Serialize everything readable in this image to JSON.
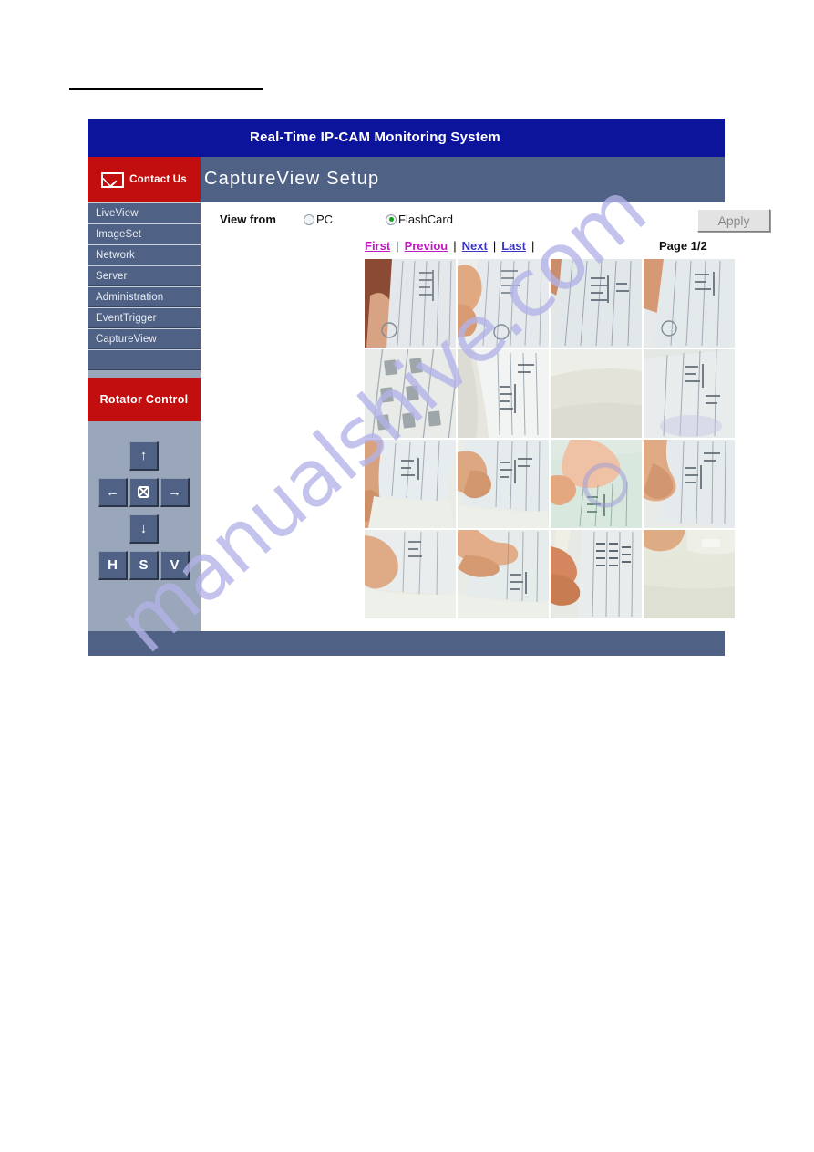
{
  "window": {
    "title": "Real-Time IP-CAM Monitoring System",
    "page_heading": "CaptureView Setup",
    "contact_us_label": "Contact Us",
    "contact_us_icon": "envelope-icon"
  },
  "colors": {
    "title_bar": "#0C149C",
    "header_band": "#4F6184",
    "accent_red": "#C20E0E",
    "sidebar_bg": "#9AA6BA",
    "nav_item": "#4F6184",
    "link_visited": "#C219C2",
    "link_fresh": "#3A34C9",
    "radio_checked": "#11A011",
    "watermark": "#B3B3E8"
  },
  "sidebar": {
    "items": [
      {
        "label": "LiveView"
      },
      {
        "label": "ImageSet"
      },
      {
        "label": "Network"
      },
      {
        "label": "Server"
      },
      {
        "label": "Administration"
      },
      {
        "label": "EventTrigger"
      },
      {
        "label": "CaptureView"
      },
      {
        "label": ""
      }
    ],
    "rotator": {
      "title": "Rotator Control",
      "buttons": [
        {
          "name": "up",
          "glyph": "↑",
          "icon": "arrow-up-icon"
        },
        {
          "name": "left",
          "glyph": "←",
          "icon": "arrow-left-icon"
        },
        {
          "name": "home",
          "glyph": "",
          "icon": "home-reset-icon"
        },
        {
          "name": "right",
          "glyph": "→",
          "icon": "arrow-right-icon"
        },
        {
          "name": "down",
          "glyph": "↓",
          "icon": "arrow-down-icon"
        },
        {
          "name": "h",
          "glyph": "H",
          "icon": "horizontal-scan-icon"
        },
        {
          "name": "s",
          "glyph": "S",
          "icon": "stop-scan-icon"
        },
        {
          "name": "v",
          "glyph": "V",
          "icon": "vertical-scan-icon"
        }
      ]
    }
  },
  "content": {
    "view_from": {
      "label": "View from",
      "options": [
        {
          "label": "PC",
          "checked": false
        },
        {
          "label": "FlashCard",
          "checked": true
        }
      ]
    },
    "apply_label": "Apply",
    "pager": {
      "first": "First",
      "previous": "Previou",
      "next": "Next",
      "last": "Last",
      "separator": "|",
      "page_indicator": "Page 1/2"
    },
    "thumbnails": {
      "rows": 4,
      "columns": 4,
      "count": 16,
      "items": [
        {
          "caption": "hand holding printed form, red-brown sleeve at left, round stamp lower-left"
        },
        {
          "caption": "fingers gripping white document sheet, round stamp lower-centre"
        },
        {
          "caption": "tilted printed form with columns of characters"
        },
        {
          "caption": "hand at left edge holding form, round stamp lower-left"
        },
        {
          "caption": "close-up of ruled table cells on pale paper"
        },
        {
          "caption": "curled white page with printed text block"
        },
        {
          "caption": "blurred pale paper surface, out of focus"
        },
        {
          "caption": "printed form on desk, lower right corner"
        },
        {
          "caption": "hand holding folded printed sheet"
        },
        {
          "caption": "fingers pointing at printed form rows"
        },
        {
          "caption": "pale green tinted paper with fingers over it"
        },
        {
          "caption": "hand with finger on form, text column at right"
        },
        {
          "caption": "blurred hand over white paper"
        },
        {
          "caption": "fingers resting on printed page"
        },
        {
          "caption": "two fingers crossing a printed chart"
        },
        {
          "caption": "hand at top-left over pale cream surface"
        }
      ]
    }
  },
  "watermark": {
    "text": "manualshive.com"
  }
}
